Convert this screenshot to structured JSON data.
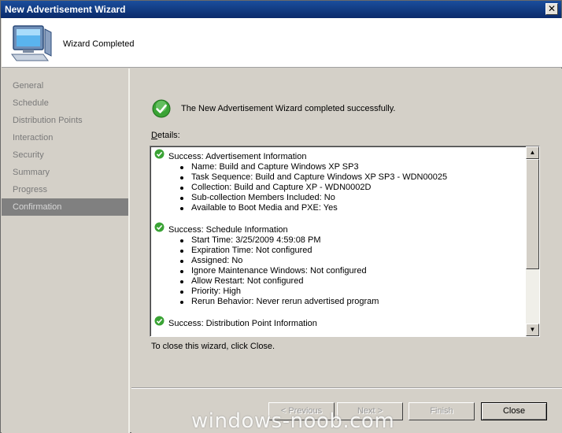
{
  "window": {
    "title": "New Advertisement Wizard",
    "close_glyph": "✕"
  },
  "header": {
    "title": "Wizard Completed",
    "icon": "computer-icon"
  },
  "sidebar": {
    "items": [
      {
        "label": "General"
      },
      {
        "label": "Schedule"
      },
      {
        "label": "Distribution Points"
      },
      {
        "label": "Interaction"
      },
      {
        "label": "Security"
      },
      {
        "label": "Summary"
      },
      {
        "label": "Progress"
      },
      {
        "label": "Confirmation",
        "active": true
      }
    ]
  },
  "main": {
    "success_message": "The New Advertisement Wizard completed successfully.",
    "details_label_first": "D",
    "details_label_rest": "etails:",
    "close_hint": "To close this wizard, click Close."
  },
  "details": {
    "sections": [
      {
        "title": "Success: Advertisement Information",
        "items": [
          "Name: Build and Capture Windows XP SP3",
          "Task Sequence: Build and Capture Windows XP SP3 - WDN00025",
          "Collection: Build and Capture XP - WDN0002D",
          "Sub-collection Members Included: No",
          "Available to Boot Media and PXE: Yes"
        ]
      },
      {
        "title": "Success: Schedule Information",
        "items": [
          "Start Time: 3/25/2009 4:59:08 PM",
          "Expiration Time: Not configured",
          "Assigned: No",
          "Ignore Maintenance Windows: Not configured",
          "Allow Restart: Not configured",
          "Priority: High",
          "Rerun Behavior: Never rerun advertised program"
        ]
      },
      {
        "title": "Success: Distribution Point Information",
        "items": []
      }
    ]
  },
  "buttons": {
    "previous": "< Previous",
    "next": "Next >",
    "finish": "Finish",
    "close": "Close"
  },
  "watermark": "windows-noob.com",
  "colors": {
    "titlebar": "#0a2a6a",
    "success": "#3aa335",
    "active_item": "#808080"
  }
}
